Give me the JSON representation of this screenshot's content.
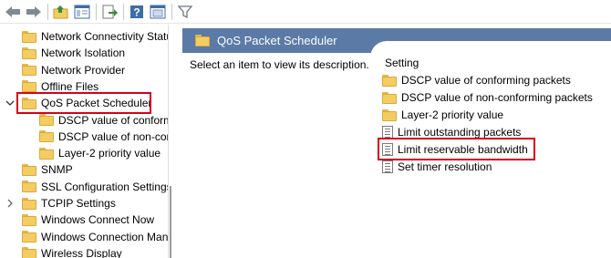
{
  "toolbar": {
    "buttons": [
      {
        "name": "back",
        "icon": "back-arrow-icon"
      },
      {
        "name": "forward",
        "icon": "forward-arrow-icon"
      },
      {
        "name": "up-folder",
        "icon": "folder-up-icon"
      },
      {
        "name": "show-hide-tree",
        "icon": "console-tree-icon"
      },
      {
        "name": "export-list",
        "icon": "export-list-icon"
      },
      {
        "name": "help",
        "icon": "help-icon"
      },
      {
        "name": "properties",
        "icon": "properties-icon"
      },
      {
        "name": "filter",
        "icon": "filter-icon"
      }
    ]
  },
  "tree": {
    "items": [
      {
        "label": "Network Connectivity Status Indicator",
        "indent": 0,
        "twisty": "",
        "selected": false
      },
      {
        "label": "Network Isolation",
        "indent": 0,
        "twisty": "",
        "selected": false
      },
      {
        "label": "Network Provider",
        "indent": 0,
        "twisty": "",
        "selected": false
      },
      {
        "label": "Offline Files",
        "indent": 0,
        "twisty": "",
        "selected": false
      },
      {
        "label": "QoS Packet Scheduler",
        "indent": 0,
        "twisty": "expanded",
        "selected": true
      },
      {
        "label": "DSCP value of conforming packets",
        "indent": 1,
        "twisty": "",
        "selected": false
      },
      {
        "label": "DSCP value of non-conforming packets",
        "indent": 1,
        "twisty": "",
        "selected": false
      },
      {
        "label": "Layer-2 priority value",
        "indent": 1,
        "twisty": "",
        "selected": false
      },
      {
        "label": "SNMP",
        "indent": 0,
        "twisty": "",
        "selected": false
      },
      {
        "label": "SSL Configuration Settings",
        "indent": 0,
        "twisty": "",
        "selected": false
      },
      {
        "label": "TCPIP Settings",
        "indent": 0,
        "twisty": "collapsed",
        "selected": false
      },
      {
        "label": "Windows Connect Now",
        "indent": 0,
        "twisty": "",
        "selected": false
      },
      {
        "label": "Windows Connection Manager",
        "indent": 0,
        "twisty": "",
        "selected": false
      },
      {
        "label": "Wireless Display",
        "indent": 0,
        "twisty": "",
        "selected": false
      }
    ]
  },
  "details": {
    "title": "QoS Packet Scheduler",
    "description": "Select an item to view its description.",
    "column_header": "Setting",
    "items": [
      {
        "label": "DSCP value of conforming packets",
        "type": "folder"
      },
      {
        "label": "DSCP value of non-conforming packets",
        "type": "folder"
      },
      {
        "label": "Layer-2 priority value",
        "type": "folder"
      },
      {
        "label": "Limit outstanding packets",
        "type": "setting"
      },
      {
        "label": "Limit reservable bandwidth",
        "type": "setting",
        "highlighted": true
      },
      {
        "label": "Set timer resolution",
        "type": "setting"
      }
    ]
  },
  "colors": {
    "header_band": "#5b7aa6",
    "highlight_border": "#d6001c",
    "folder": "#f4cd62"
  }
}
